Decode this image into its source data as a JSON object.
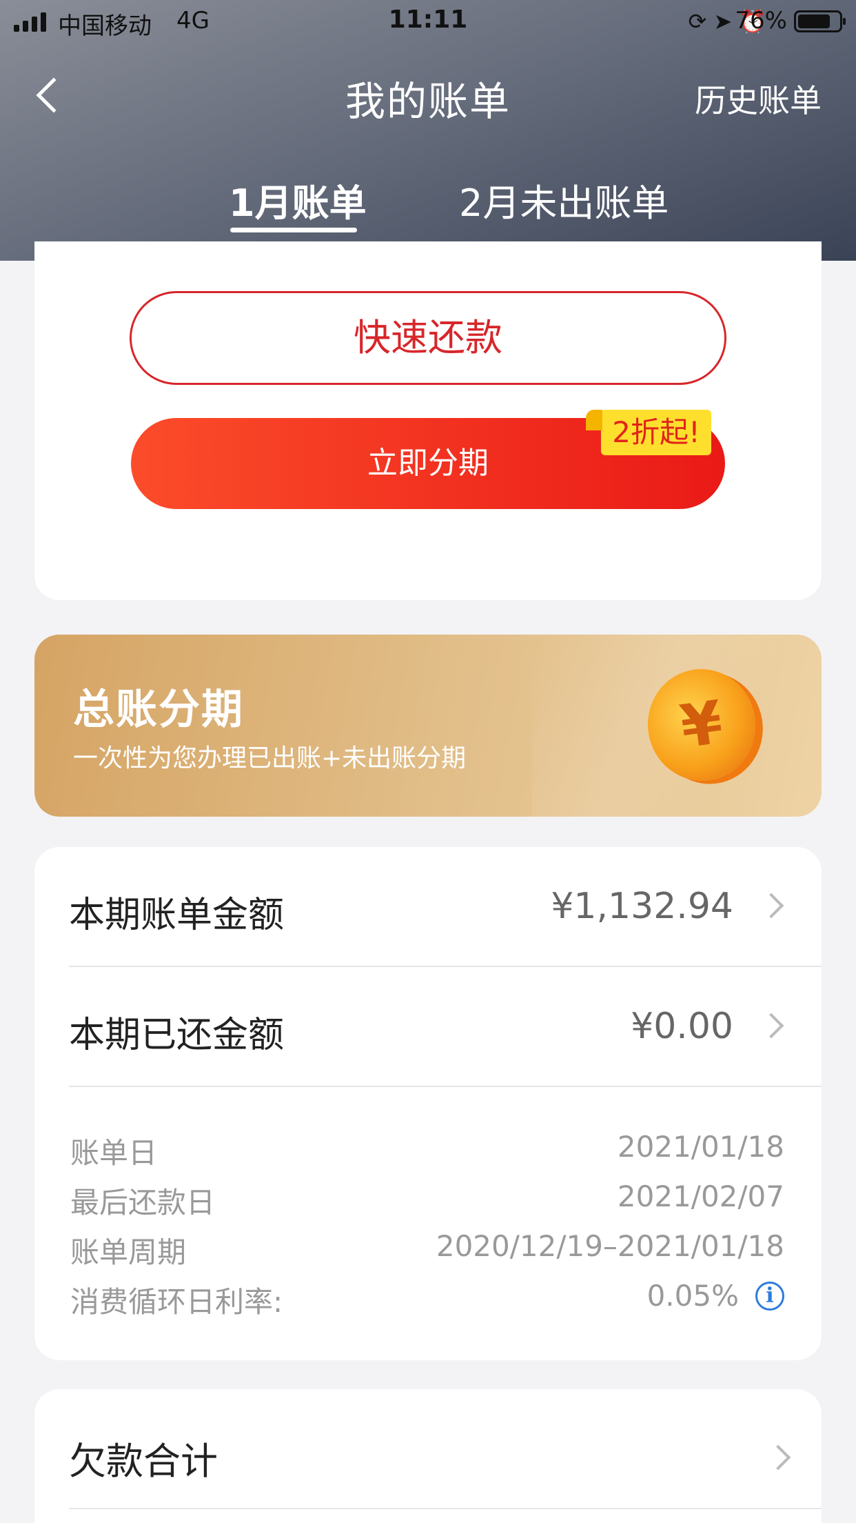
{
  "status_bar": {
    "carrier": "中国移动",
    "network": "4G",
    "time": "11:11",
    "battery_pct": "76%",
    "icons": [
      "lock-rotation-icon",
      "location-icon",
      "alarm-icon"
    ]
  },
  "header": {
    "title": "我的账单",
    "history_link": "历史账单",
    "tabs": [
      {
        "label": "1月账单",
        "active": true
      },
      {
        "label": "2月未出账单",
        "active": false
      }
    ]
  },
  "actions": {
    "quick_pay_label": "快速还款",
    "installment_label": "立即分期",
    "discount_badge": "2折起!"
  },
  "promo": {
    "title": "总账分期",
    "subtitle": "一次性为您办理已出账+未出账分期",
    "coin_symbol": "¥"
  },
  "bill": {
    "rows": [
      {
        "label": "本期账单金额",
        "value": "¥1,132.94"
      },
      {
        "label": "本期已还金额",
        "value": "¥0.00"
      }
    ],
    "info": [
      {
        "label": "账单日",
        "value": "2021/01/18"
      },
      {
        "label": "最后还款日",
        "value": "2021/02/07"
      },
      {
        "label": "账单周期",
        "value": "2020/12/19–2021/01/18"
      },
      {
        "label": "消费循环日利率:",
        "value": "0.05%"
      }
    ]
  },
  "debt": {
    "label": "欠款合计"
  },
  "colors": {
    "accent_red": "#d7262a",
    "header_gradient": [
      "#8a8e98",
      "#3a4356"
    ],
    "promo_gold": "#d5a464",
    "info_blue": "#2d7bdf"
  }
}
